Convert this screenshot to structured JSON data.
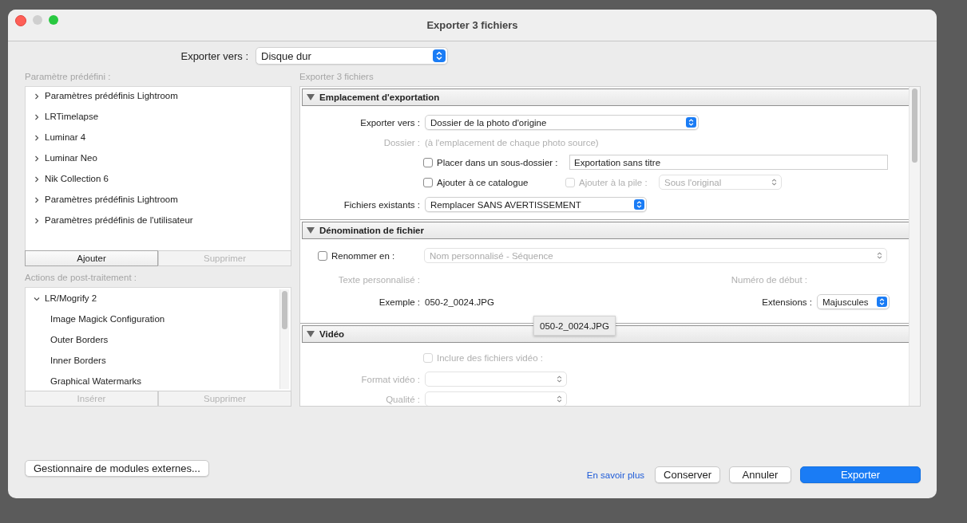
{
  "window": {
    "title": "Exporter 3 fichiers"
  },
  "export_to": {
    "label": "Exporter vers :",
    "value": "Disque dur"
  },
  "presets": {
    "label": "Paramètre prédéfini :",
    "items": [
      {
        "label": "Paramètres prédéfinis Lightroom",
        "expanded": false
      },
      {
        "label": "LRTimelapse",
        "expanded": false
      },
      {
        "label": "Luminar 4",
        "expanded": false
      },
      {
        "label": "Luminar Neo",
        "expanded": false
      },
      {
        "label": "Nik Collection 6",
        "expanded": false
      },
      {
        "label": "Paramètres prédéfinis Lightroom",
        "expanded": false
      },
      {
        "label": "Paramètres prédéfinis de l'utilisateur",
        "expanded": false
      }
    ],
    "buttons": [
      {
        "label": "Ajouter",
        "disabled": false
      },
      {
        "label": "Supprimer",
        "disabled": true
      }
    ]
  },
  "post_actions": {
    "label": "Actions de post-traitement :",
    "items": [
      {
        "label": "LR/Mogrify 2",
        "expanded": true,
        "children": [
          {
            "label": "Image Magick Configuration"
          },
          {
            "label": "Outer Borders"
          },
          {
            "label": "Inner Borders"
          },
          {
            "label": "Graphical Watermarks"
          }
        ]
      }
    ],
    "buttons": [
      {
        "label": "Insérer",
        "disabled": true
      },
      {
        "label": "Supprimer",
        "disabled": true
      }
    ]
  },
  "panel": {
    "label": "Exporter 3 fichiers",
    "location": {
      "title": "Emplacement d'exportation",
      "expanded": true,
      "export_to": {
        "label": "Exporter vers :",
        "value": "Dossier de la photo d'origine"
      },
      "folder": {
        "label": "Dossier :",
        "value": "(à l'emplacement de chaque photo source)",
        "disabled": true
      },
      "subfolder": {
        "label": "Placer dans un sous-dossier :",
        "checked": false,
        "value": "Exportation sans titre"
      },
      "add_catalog": {
        "label": "Ajouter à ce catalogue",
        "checked": false
      },
      "add_stack": {
        "label": "Ajouter à la pile :",
        "checked": false,
        "disabled": true
      },
      "stack_position": {
        "value": "Sous l'original",
        "disabled": true
      },
      "existing": {
        "label": "Fichiers existants :",
        "value": "Remplacer SANS AVERTISSEMENT"
      }
    },
    "naming": {
      "title": "Dénomination de fichier",
      "expanded": true,
      "rename": {
        "label": "Renommer en :",
        "checked": false
      },
      "template": {
        "value": "Nom personnalisé - Séquence",
        "disabled": true
      },
      "custom_text": {
        "label": "Texte personnalisé :",
        "disabled": true
      },
      "start_number": {
        "label": "Numéro de début :",
        "disabled": true
      },
      "example": {
        "label": "Exemple :",
        "value": "050-2_0024.JPG"
      },
      "extensions": {
        "label": "Extensions :",
        "value": "Majuscules"
      }
    },
    "video": {
      "title": "Vidéo",
      "expanded": true,
      "include": {
        "label": "Inclure des fichiers vidéo :",
        "checked": false,
        "disabled": true
      },
      "format": {
        "label": "Format vidéo :",
        "disabled": true
      },
      "quality": {
        "label": "Qualité :",
        "disabled": true
      }
    },
    "tooltip": "050-2_0024.JPG"
  },
  "footer": {
    "plugin_manager": "Gestionnaire de modules externes...",
    "learn_more": "En savoir plus",
    "buttons": [
      {
        "label": "Conserver",
        "kind": "normal"
      },
      {
        "label": "Annuler",
        "kind": "normal"
      },
      {
        "label": "Exporter",
        "kind": "primary"
      }
    ]
  }
}
